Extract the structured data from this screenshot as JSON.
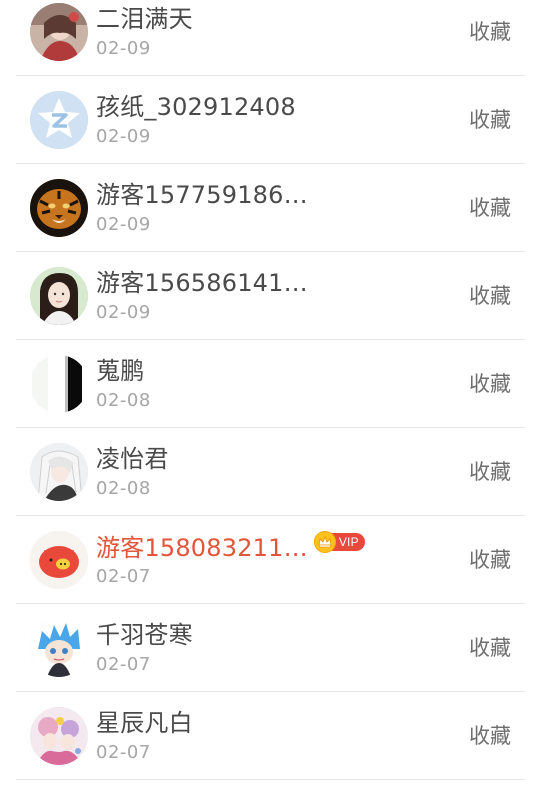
{
  "collections": [
    {
      "name": "二泪满天",
      "date": "02-09",
      "action": "收藏",
      "vip": false,
      "avatar": "avatar-girl-red"
    },
    {
      "name": "孩纸_302912408",
      "date": "02-09",
      "action": "收藏",
      "vip": false,
      "avatar": "avatar-default-qzone"
    },
    {
      "name": "游客157759186…",
      "date": "02-09",
      "action": "收藏",
      "vip": false,
      "avatar": "avatar-tiger"
    },
    {
      "name": "游客156586141…",
      "date": "02-09",
      "action": "收藏",
      "vip": false,
      "avatar": "avatar-girl-portrait"
    },
    {
      "name": "蒐鹏",
      "date": "02-08",
      "action": "收藏",
      "vip": false,
      "avatar": "avatar-black-bar"
    },
    {
      "name": "凌怡君",
      "date": "02-08",
      "action": "收藏",
      "vip": false,
      "avatar": "avatar-anime-white-hair"
    },
    {
      "name": "游客158083211…",
      "date": "02-07",
      "action": "收藏",
      "vip": true,
      "vip_label": "VIP",
      "avatar": "avatar-red-pig"
    },
    {
      "name": "千羽苍寒",
      "date": "02-07",
      "action": "收藏",
      "vip": false,
      "avatar": "avatar-anime-blue-hair"
    },
    {
      "name": "星辰凡白",
      "date": "02-07",
      "action": "收藏",
      "vip": false,
      "avatar": "avatar-anime-pink"
    }
  ],
  "colors": {
    "vip_name": "#e2553b",
    "vip_badge": "#e8493b",
    "crown": "#ffc21f",
    "divider": "#e7e7e7"
  }
}
